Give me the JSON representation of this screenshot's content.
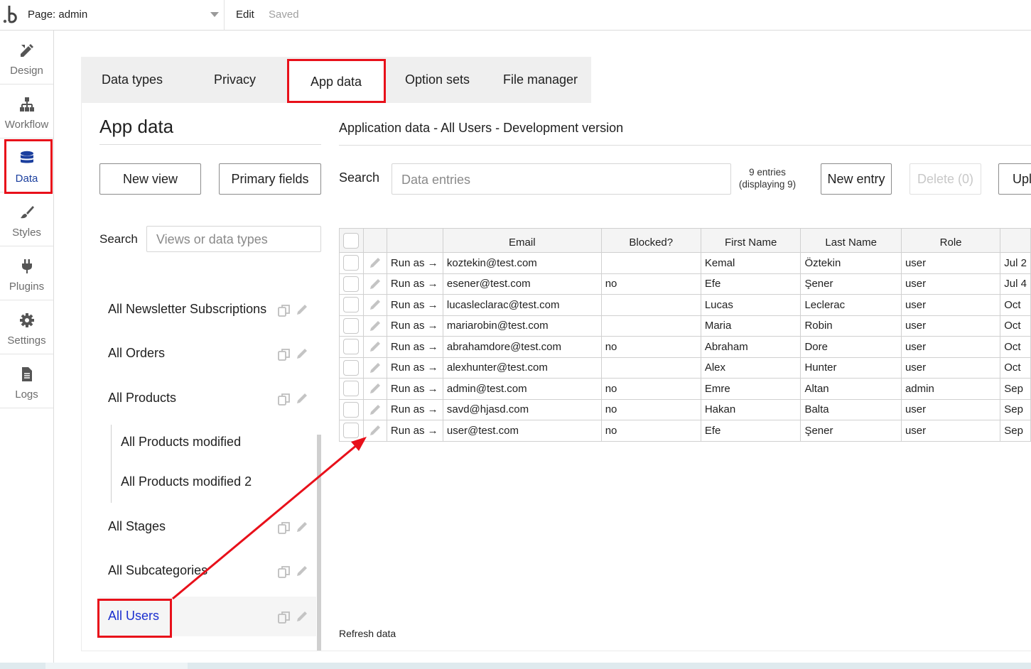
{
  "topbar": {
    "page_label": "Page: admin",
    "edit": "Edit",
    "saved": "Saved"
  },
  "sidebar": {
    "items": [
      {
        "label": "Design",
        "icon": "design-icon"
      },
      {
        "label": "Workflow",
        "icon": "workflow-icon"
      },
      {
        "label": "Data",
        "icon": "database-icon",
        "active": true
      },
      {
        "label": "Styles",
        "icon": "brush-icon"
      },
      {
        "label": "Plugins",
        "icon": "plug-icon"
      },
      {
        "label": "Settings",
        "icon": "gear-icon"
      },
      {
        "label": "Logs",
        "icon": "document-icon"
      }
    ]
  },
  "tabs": [
    "Data types",
    "Privacy",
    "App data",
    "Option sets",
    "File manager"
  ],
  "active_tab": "App data",
  "left": {
    "heading": "App data",
    "new_view": "New view",
    "primary_fields": "Primary fields",
    "search_label": "Search",
    "search_placeholder": "Views or data types",
    "types": [
      {
        "label": "All Newsletter Subscriptions"
      },
      {
        "label": "All Orders"
      },
      {
        "label": "All Products"
      },
      {
        "label": "All Products modified"
      },
      {
        "label": "All Products modified 2"
      },
      {
        "label": "All Stages"
      },
      {
        "label": "All Subcategories"
      },
      {
        "label": "All Users",
        "selected": true
      }
    ]
  },
  "right": {
    "title": "Application data - All Users - Development version",
    "search_label": "Search",
    "search_placeholder": "Data entries",
    "entries_line1": "9 entries",
    "entries_line2": "(displaying 9)",
    "new_entry": "New entry",
    "delete": "Delete (0)",
    "upload": "Upl",
    "refresh": "Refresh data"
  },
  "table": {
    "columns": [
      "Email",
      "Blocked?",
      "First Name",
      "Last Name",
      "Role"
    ],
    "run_as": "Run as →",
    "rows": [
      {
        "email": "koztekin@test.com",
        "blocked": "",
        "first": "Kemal",
        "last": "Öztekin",
        "role": "user",
        "date": "Jul 2"
      },
      {
        "email": "esener@test.com",
        "blocked": "no",
        "first": "Efe",
        "last": "Şener",
        "role": "user",
        "date": "Jul 4"
      },
      {
        "email": "lucasleclarac@test.com",
        "blocked": "",
        "first": "Lucas",
        "last": "Leclerac",
        "role": "user",
        "date": "Oct"
      },
      {
        "email": "mariarobin@test.com",
        "blocked": "",
        "first": "Maria",
        "last": "Robin",
        "role": "user",
        "date": "Oct"
      },
      {
        "email": "abrahamdore@test.com",
        "blocked": "no",
        "first": "Abraham",
        "last": "Dore",
        "role": "user",
        "date": "Oct"
      },
      {
        "email": "alexhunter@test.com",
        "blocked": "",
        "first": "Alex",
        "last": "Hunter",
        "role": "user",
        "date": "Oct"
      },
      {
        "email": "admin@test.com",
        "blocked": "no",
        "first": "Emre",
        "last": "Altan",
        "role": "admin",
        "date": "Sep"
      },
      {
        "email": "savd@hjasd.com",
        "blocked": "no",
        "first": "Hakan",
        "last": "Balta",
        "role": "user",
        "date": "Sep"
      },
      {
        "email": "user@test.com",
        "blocked": "no",
        "first": "Efe",
        "last": "Şener",
        "role": "user",
        "date": "Sep"
      }
    ]
  },
  "colors": {
    "highlight": "#e8101a",
    "active_nav": "#1b3f9e",
    "selected_type": "#1b2fcf"
  }
}
